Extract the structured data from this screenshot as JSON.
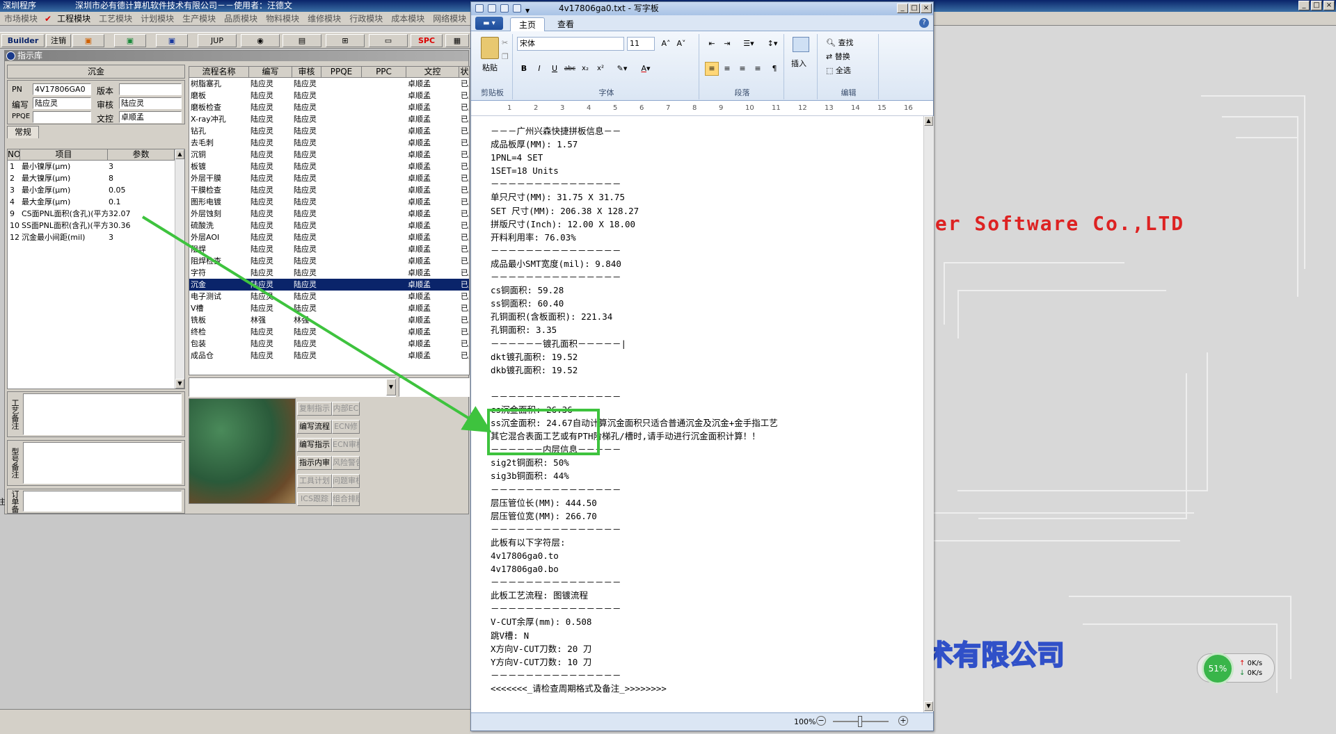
{
  "app": {
    "title": "深圳程序",
    "company_user": "深圳市必有德计算机软件技术有限公司－－使用者：汪德文"
  },
  "menu": [
    "市场模块",
    "工程模块",
    "工艺模块",
    "计划模块",
    "生产模块",
    "品质模块",
    "物料模块",
    "维修模块",
    "行政模块",
    "成本模块",
    "网络模块"
  ],
  "toolbar": {
    "builder": "Builder",
    "logout": "注销",
    "jup": "JUP",
    "spc": "SPC"
  },
  "lib": {
    "title": "指示库",
    "process_header": "沉金",
    "fields": {
      "pn_label": "PN",
      "pn_value": "4V17806GA0",
      "version_label": "版本",
      "version_value": "",
      "author_label": "编写",
      "author_value": "陆应灵",
      "review_label": "审核",
      "review_value": "陆应灵",
      "ppqe_label": "PPQE",
      "ppqe_value": "",
      "doc_label": "文控",
      "doc_value": "卓顺孟"
    },
    "tab_normal": "常规",
    "param_headers": [
      "NO",
      "项目",
      "参数"
    ],
    "params": [
      [
        "1",
        "最小镍厚(μm)",
        "3"
      ],
      [
        "2",
        "最大镍厚(μm)",
        "8"
      ],
      [
        "3",
        "最小金厚(μm)",
        "0.05"
      ],
      [
        "4",
        "最大金厚(μm)",
        "0.1"
      ],
      [
        "9",
        "CS面PNL面积(含孔)(平方",
        "32.07"
      ],
      [
        "10",
        "SS面PNL面积(含孔)(平方",
        "30.36"
      ],
      [
        "12",
        "沉金最小间距(mil)",
        "3"
      ]
    ],
    "notes": [
      "工艺备注",
      "型号备注",
      "订单备注"
    ],
    "flow_headers": [
      "流程名称",
      "编写",
      "审核",
      "PPQE",
      "PPC",
      "文控",
      "状"
    ],
    "flows": [
      [
        "树脂塞孔",
        "陆应灵",
        "陆应灵",
        "",
        "",
        "卓顺孟",
        "已上"
      ],
      [
        "磨板",
        "陆应灵",
        "陆应灵",
        "",
        "",
        "卓顺孟",
        "已上"
      ],
      [
        "磨板检查",
        "陆应灵",
        "陆应灵",
        "",
        "",
        "卓顺孟",
        "已上"
      ],
      [
        "X-ray冲孔",
        "陆应灵",
        "陆应灵",
        "",
        "",
        "卓顺孟",
        "已上"
      ],
      [
        "钻孔",
        "陆应灵",
        "陆应灵",
        "",
        "",
        "卓顺孟",
        "已上"
      ],
      [
        "去毛刺",
        "陆应灵",
        "陆应灵",
        "",
        "",
        "卓顺孟",
        "已上"
      ],
      [
        "沉铜",
        "陆应灵",
        "陆应灵",
        "",
        "",
        "卓顺孟",
        "已上"
      ],
      [
        "板镀",
        "陆应灵",
        "陆应灵",
        "",
        "",
        "卓顺孟",
        "已上"
      ],
      [
        "外层干膜",
        "陆应灵",
        "陆应灵",
        "",
        "",
        "卓顺孟",
        "已上"
      ],
      [
        "干膜检查",
        "陆应灵",
        "陆应灵",
        "",
        "",
        "卓顺孟",
        "已上"
      ],
      [
        "图形电镀",
        "陆应灵",
        "陆应灵",
        "",
        "",
        "卓顺孟",
        "已上"
      ],
      [
        "外层蚀刻",
        "陆应灵",
        "陆应灵",
        "",
        "",
        "卓顺孟",
        "已上"
      ],
      [
        "硫酸洗",
        "陆应灵",
        "陆应灵",
        "",
        "",
        "卓顺孟",
        "已上"
      ],
      [
        "外层AOI",
        "陆应灵",
        "陆应灵",
        "",
        "",
        "卓顺孟",
        "已上"
      ],
      [
        "阻焊",
        "陆应灵",
        "陆应灵",
        "",
        "",
        "卓顺孟",
        "已上"
      ],
      [
        "阻焊检查",
        "陆应灵",
        "陆应灵",
        "",
        "",
        "卓顺孟",
        "已上"
      ],
      [
        "字符",
        "陆应灵",
        "陆应灵",
        "",
        "",
        "卓顺孟",
        "已上"
      ],
      [
        "沉金",
        "陆应灵",
        "陆应灵",
        "",
        "",
        "卓顺孟",
        "已上"
      ],
      [
        "电子测试",
        "陆应灵",
        "陆应灵",
        "",
        "",
        "卓顺孟",
        "已上"
      ],
      [
        "V槽",
        "陆应灵",
        "陆应灵",
        "",
        "",
        "卓顺孟",
        "已上"
      ],
      [
        "铣板",
        "林强",
        "林强",
        "",
        "",
        "卓顺孟",
        "已上"
      ],
      [
        "终检",
        "陆应灵",
        "陆应灵",
        "",
        "",
        "卓顺孟",
        "已上"
      ],
      [
        "包装",
        "陆应灵",
        "陆应灵",
        "",
        "",
        "卓顺孟",
        "已上"
      ],
      [
        "成品仓",
        "陆应灵",
        "陆应灵",
        "",
        "",
        "卓顺孟",
        "已上"
      ]
    ],
    "selected_flow": 17,
    "buttons": [
      [
        "复制指示",
        "内部EC"
      ],
      [
        "编写流程",
        "ECN修"
      ],
      [
        "编写指示",
        "ECN审核"
      ],
      [
        "指示内审",
        "风险警告"
      ],
      [
        "工具计划",
        "问题审核"
      ],
      [
        "ICS跟踪",
        "组合排版"
      ]
    ]
  },
  "wordpad": {
    "title": "4v17806ga0.txt - 写字板",
    "tabs": {
      "home": "主页",
      "view": "查看"
    },
    "groups": {
      "clipboard": "剪贴板",
      "font": "字体",
      "paragraph": "段落",
      "editing": "编辑"
    },
    "paste": "粘贴",
    "font_name": "宋体",
    "font_size": "11",
    "insert": "插入",
    "find": "查找",
    "replace": "替换",
    "select_all": "全选",
    "ruler": [
      "1",
      "2",
      "3",
      "4",
      "5",
      "6",
      "7",
      "8",
      "9",
      "10",
      "11",
      "12",
      "13",
      "14",
      "15",
      "16"
    ],
    "zoom": "100%",
    "lines": [
      "－－－广州兴森快捷拼板信息－－",
      "成品板厚(MM): 1.57",
      "1PNL=4 SET",
      "1SET=18 Units",
      "－－－－－－－－－－－－－－－",
      "单只尺寸(MM): 31.75 X 31.75",
      "SET 尺寸(MM): 206.38 X 128.27",
      "拼版尺寸(Inch): 12.00 X 18.00",
      "开料利用率: 76.03%",
      "－－－－－－－－－－－－－－－",
      "成品最小SMT宽度(mil): 9.840",
      "－－－－－－－－－－－－－－－",
      "cs铜面积: 59.28",
      "ss铜面积: 60.40",
      "孔铜面积(含板面积): 221.34",
      "孔铜面积: 3.35",
      "－－－－－－镀孔面积－－－－－|",
      "dkt镀孔面积: 19.52",
      "dkb镀孔面积: 19.52",
      "",
      "－－－－－－－－－－－－－－－",
      "cs沉金面积: 26.36",
      "ss沉金面积: 24.67自动计算沉金面积只适合普通沉金及沉金+金手指工艺",
      "其它混合表面工艺或有PTH阶梯孔/槽时,请手动进行沉金面积计算！！",
      "－－－－－－内层信息－－－－－",
      "sig2t铜面积: 50%",
      "sig3b铜面积: 44%",
      "－－－－－－－－－－－－－－－",
      "层压管位长(MM): 444.50",
      "层压管位宽(MM): 266.70",
      "－－－－－－－－－－－－－－－",
      "此板有以下字符层:",
      "4v17806ga0.to",
      "4v17806ga0.bo",
      "－－－－－－－－－－－－－－－",
      "此板工艺流程: 图镀流程",
      "－－－－－－－－－－－－－－－",
      "V-CUT余厚(mm): 0.508",
      "跳V槽: N",
      "X方向V-CUT刀数: 20 刀",
      "Y方向V-CUT刀数: 10 刀",
      "－－－－－－－－－－－－－－－",
      "<<<<<<<_请检查周期格式及备注_>>>>>>>>"
    ]
  },
  "desktop": {
    "company_en": "der Software Co.,LTD",
    "company_cn": "术有限公司"
  },
  "netmon": {
    "percent": "51%",
    "up": "0K/s",
    "down": "0K/s"
  },
  "colors": {
    "accent": "#0a246a",
    "highlight": "#3ec33e",
    "brand_red": "#dd2222"
  }
}
